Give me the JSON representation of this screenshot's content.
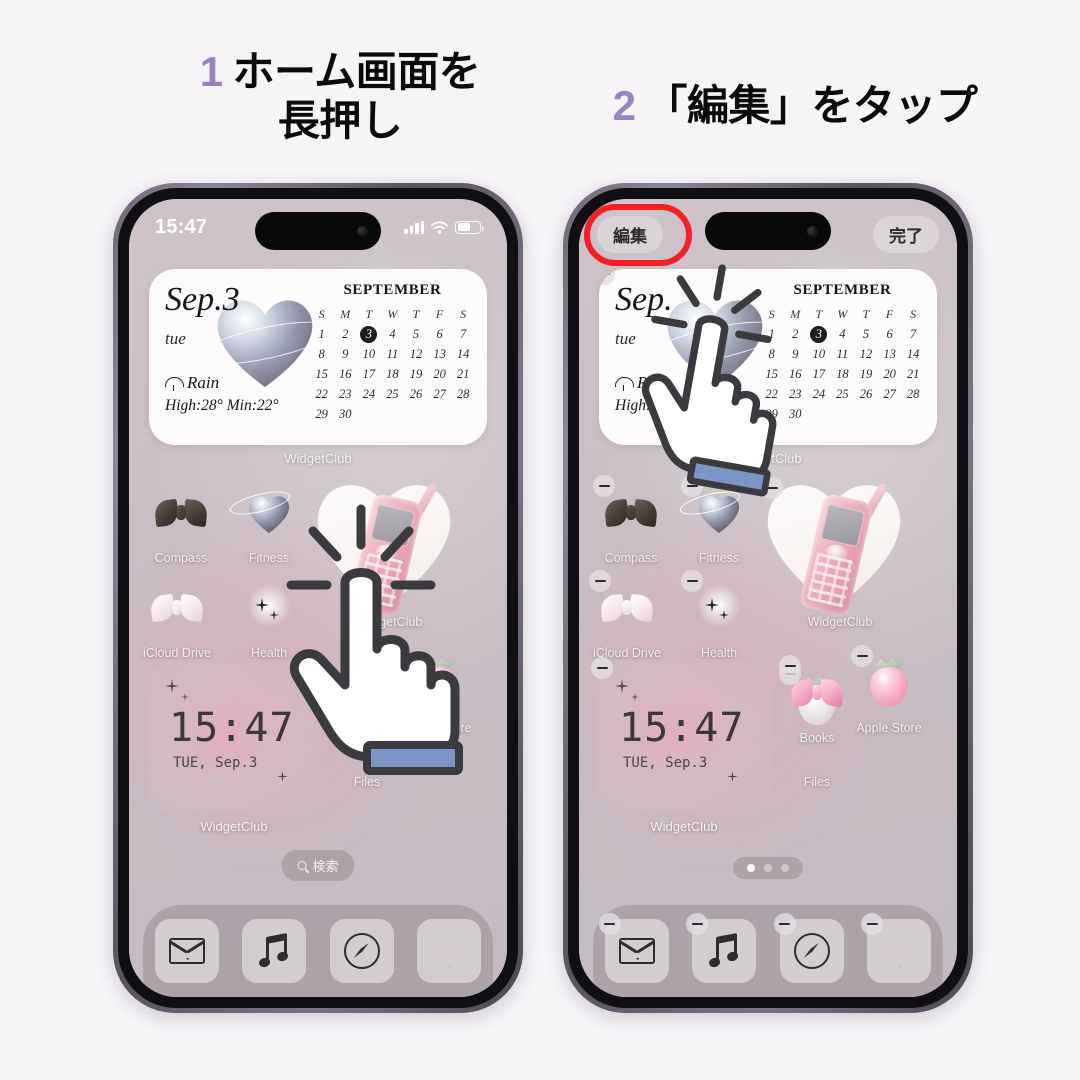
{
  "steps": [
    {
      "number": "1",
      "text_line1": "ホーム画面を",
      "text_line2": "長押し"
    },
    {
      "number": "2",
      "text_line1": "「編集」をタップ",
      "text_line2": ""
    }
  ],
  "accent_color": "#9a84bd",
  "highlight_color": "#f51f28",
  "phone1": {
    "status": {
      "time": "15:47",
      "signal_icon": "signal-bars-icon",
      "wifi_icon": "wifi-icon",
      "battery_icon": "battery-icon"
    },
    "calendar_widget": {
      "date": "Sep.3",
      "day_of_week": "tue",
      "weather": "Rain",
      "temps": "High:28° Min:22°",
      "month": "SEPTEMBER",
      "dow_headers": [
        "S",
        "M",
        "T",
        "W",
        "T",
        "F",
        "S"
      ],
      "days": [
        "1",
        "2",
        "3",
        "4",
        "5",
        "6",
        "7",
        "8",
        "9",
        "10",
        "11",
        "12",
        "13",
        "14",
        "15",
        "16",
        "17",
        "18",
        "19",
        "20",
        "21",
        "22",
        "23",
        "24",
        "25",
        "26",
        "27",
        "28",
        "29",
        "30"
      ],
      "today": "3",
      "label": "WidgetClub"
    },
    "apps": [
      {
        "name": "Compass",
        "icon": "dark-bow-icon"
      },
      {
        "name": "Fitness",
        "icon": "chrome-heart-icon"
      },
      {
        "name": "WidgetClub",
        "icon": "pink-phone-heart-icon"
      },
      {
        "name": "iCloud Drive",
        "icon": "white-bow-icon"
      },
      {
        "name": "Health",
        "icon": "sparkle-icon"
      },
      {
        "name": "Apple Store",
        "icon": "pink-strawberry-icon"
      },
      {
        "name": "Files",
        "icon": "white-strawberry-icon"
      }
    ],
    "clock_widget": {
      "time": "15:47",
      "subtitle": "TUE, Sep.3",
      "label": "WidgetClub"
    },
    "search": {
      "label": "検索",
      "icon": "search-icon"
    },
    "dock": [
      {
        "name": "Mail",
        "icon": "mail-icon"
      },
      {
        "name": "Music",
        "icon": "music-note-icon"
      },
      {
        "name": "Safari",
        "icon": "compass-icon"
      },
      {
        "name": "Heart",
        "icon": "heart-icon"
      }
    ]
  },
  "phone2": {
    "edit_button": "編集",
    "done_button": "完了",
    "calendar_widget": {
      "date": "Sep.",
      "day_of_week": "tue",
      "weather": "Rain",
      "temps": "High:28° Min:",
      "month": "SEPTEMBER",
      "dow_headers": [
        "S",
        "M",
        "T",
        "W",
        "T",
        "F",
        "S"
      ],
      "days": [
        "1",
        "2",
        "3",
        "4",
        "5",
        "6",
        "7",
        "8",
        "9",
        "10",
        "11",
        "12",
        "13",
        "14",
        "15",
        "16",
        "17",
        "18",
        "19",
        "20",
        "21",
        "22",
        "23",
        "24",
        "25",
        "26",
        "27",
        "28",
        "29",
        "30"
      ],
      "today": "3",
      "label": "WidgetClub"
    },
    "apps": [
      {
        "name": "Compass",
        "icon": "dark-bow-icon"
      },
      {
        "name": "Fitness",
        "icon": "chrome-heart-icon"
      },
      {
        "name": "WidgetClub",
        "icon": "pink-phone-heart-icon"
      },
      {
        "name": "iCloud Drive",
        "icon": "white-bow-icon"
      },
      {
        "name": "Health",
        "icon": "sparkle-icon"
      },
      {
        "name": "Books",
        "icon": "pink-bow-icon"
      },
      {
        "name": "Apple Store",
        "icon": "pink-strawberry-icon"
      },
      {
        "name": "Files",
        "icon": "white-strawberry-icon"
      }
    ],
    "clock_widget": {
      "time": "15:47",
      "subtitle": "TUE, Sep.3",
      "label": "WidgetClub"
    },
    "page_dots": {
      "count": 3,
      "active_index": 0
    },
    "dock": [
      {
        "name": "Mail",
        "icon": "mail-icon"
      },
      {
        "name": "Music",
        "icon": "music-note-icon"
      },
      {
        "name": "Safari",
        "icon": "compass-icon"
      },
      {
        "name": "Heart",
        "icon": "heart-icon"
      }
    ]
  }
}
